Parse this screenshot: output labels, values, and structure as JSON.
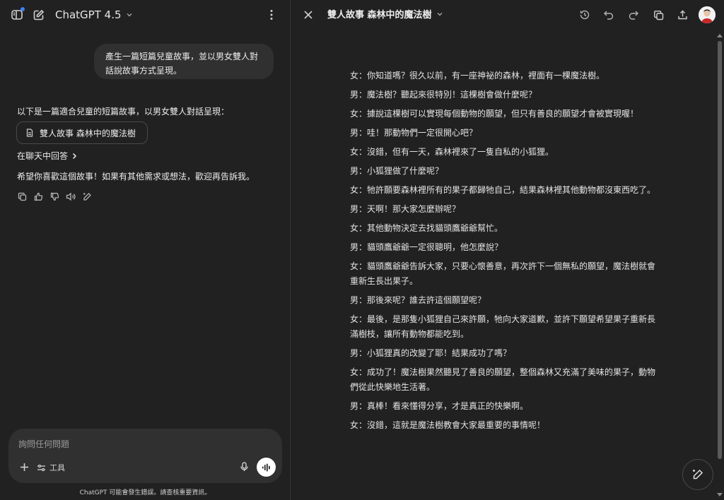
{
  "chat": {
    "model_name": "ChatGPT 4.5",
    "user_message_line1": "產生一篇短篇兒童故事，並以男女雙人對",
    "user_message_line2": "話說故事方式呈現。",
    "assistant_intro": "以下是一篇適合兒童的短篇故事，以男女雙人對話呈現：",
    "doc_chip_label": "雙人故事 森林中的魔法樹",
    "answer_in_chat": "在聊天中回答",
    "assistant_outro": "希望你喜歡這個故事！如果有其他需求或想法，歡迎再告訴我。"
  },
  "composer": {
    "placeholder": "詢問任何問題",
    "tools_label": "工具"
  },
  "disclaimer": "ChatGPT 可能會發生錯誤。請查核重要資訊。",
  "canvas": {
    "title": "雙人故事 森林中的魔法樹",
    "lines": [
      "女：你知道嗎？很久以前，有一座神祕的森林，裡面有一棵魔法樹。",
      "男：魔法樹？聽起來很特別！這棵樹會做什麼呢？",
      "女：據說這棵樹可以實現每個動物的願望，但只有善良的願望才會被實現喔！",
      "男：哇！那動物們一定很開心吧？",
      "女：沒錯，但有一天，森林裡來了一隻自私的小狐狸。",
      "男：小狐狸做了什麼呢？",
      "女：牠許願要森林裡所有的果子都歸牠自己，結果森林裡其他動物都沒東西吃了。",
      "男：天啊！那大家怎麼辦呢？",
      "女：其他動物決定去找貓頭鷹爺爺幫忙。",
      "男：貓頭鷹爺爺一定很聰明，他怎麼說？",
      "女：貓頭鷹爺爺告訴大家，只要心懷善意，再次許下一個無私的願望，魔法樹就會重新生長出果子。",
      "男：那後來呢？誰去許這個願望呢？",
      "女：最後，是那隻小狐狸自己來許願，牠向大家道歉，並許下願望希望果子重新長滿樹枝，讓所有動物都能吃到。",
      "男：小狐狸真的改變了耶！結果成功了嗎？",
      "女：成功了！魔法樹果然聽見了善良的願望，整個森林又充滿了美味的果子，動物們從此快樂地生活著。",
      "男：真棒！看來懂得分享，才是真正的快樂啊。",
      "女：沒錯，這就是魔法樹教會大家最重要的事情呢！"
    ]
  },
  "colors": {
    "background": "#212121",
    "bubble": "#303030",
    "accent_dot": "#3b82f6"
  }
}
